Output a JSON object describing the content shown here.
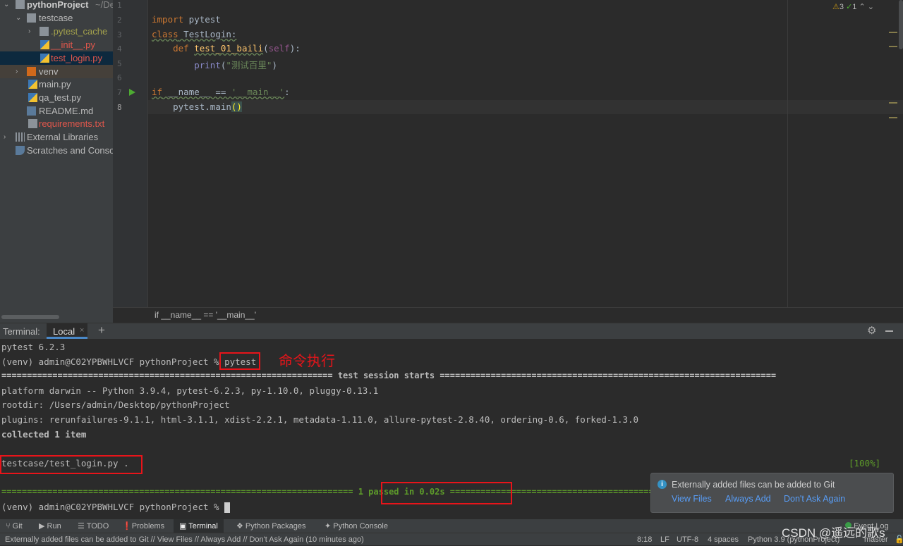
{
  "project_tree": {
    "root": {
      "name": "pythonProject",
      "path": "~/De"
    },
    "items": [
      {
        "label": "testcase",
        "color": "#bbbbbb"
      },
      {
        "label": ".pytest_cache",
        "color": "#a2a04c"
      },
      {
        "label": "__init__.py",
        "color": "#e2574c"
      },
      {
        "label": "test_login.py",
        "color": "#e2574c"
      },
      {
        "label": "venv",
        "color": "#bbbbbb"
      },
      {
        "label": "main.py",
        "color": "#bbbbbb"
      },
      {
        "label": "qa_test.py",
        "color": "#bbbbbb"
      },
      {
        "label": "README.md",
        "color": "#bbbbbb"
      },
      {
        "label": "requirements.txt",
        "color": "#e2574c"
      },
      {
        "label": "External Libraries",
        "color": "#bbbbbb"
      },
      {
        "label": "Scratches and Consoles",
        "color": "#bbbbbb"
      }
    ]
  },
  "editor": {
    "line_numbers": [
      "1",
      "2",
      "3",
      "4",
      "5",
      "6",
      "7",
      "8"
    ],
    "code": {
      "l2a": "import",
      "l2b": " pytest",
      "l3a": "class",
      "l3b": " TestLogin:",
      "l4a": "def ",
      "l4b": "test_01_baili",
      "l4c": "(",
      "l4d": "self",
      "l4e": "):",
      "l5a": "print",
      "l5b": "(",
      "l5c": "\"测试百里\"",
      "l5d": ")",
      "l7a": "if",
      "l7b": " __name__ == ",
      "l7c": "'__main__'",
      "l7d": ":",
      "l8a": "pytest.main",
      "l8b": "()"
    },
    "inspections": {
      "warnings": "3",
      "ok": "1"
    },
    "breadcrumb": "if __name__ == '__main__'"
  },
  "terminal": {
    "label": "Terminal:",
    "tab": "Local",
    "lines": [
      "pytest 6.2.3",
      "(venv) admin@C02YPBWHLVCF pythonProject % ",
      "pytest",
      "================================================================= test session starts ==================================================================",
      "platform darwin -- Python 3.9.4, pytest-6.2.3, py-1.10.0, pluggy-0.13.1",
      "rootdir: /Users/admin/Desktop/pythonProject",
      "plugins: rerunfailures-9.1.1, html-3.1.1, xdist-2.2.1, metadata-1.11.0, allure-pytest-2.8.40, ordering-0.6, forked-1.3.0",
      "collected 1 item",
      "testcase/test_login.py .",
      "[100%]",
      "===================================================================== 1 passed in 0.02s ======================================================================",
      "(venv) admin@C02YPBWHLVCF pythonProject % "
    ],
    "annotation": "命令执行"
  },
  "notification": {
    "message": "Externally added files can be added to Git",
    "actions": [
      "View Files",
      "Always Add",
      "Don't Ask Again"
    ]
  },
  "tool_windows": [
    "Git",
    "Run",
    "TODO",
    "Problems",
    "Terminal",
    "Python Packages",
    "Python Console"
  ],
  "event_log": "Event Log",
  "status": {
    "message": "Externally added files can be added to Git // View Files // Always Add // Don't Ask Again (10 minutes ago)",
    "position": "8:18",
    "line_sep": "LF",
    "encoding": "UTF-8",
    "indent": "4 spaces",
    "interpreter": "Python 3.9 (pythonProject)",
    "branch": "master"
  },
  "watermark": "CSDN @遥远的歌s"
}
